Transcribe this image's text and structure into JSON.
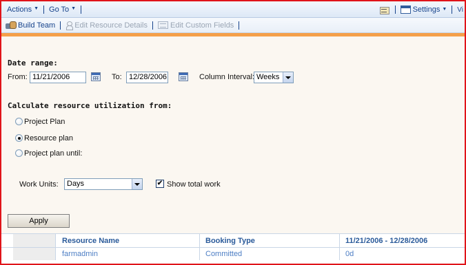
{
  "toolbar": {
    "actions_label": "Actions",
    "goto_label": "Go To",
    "settings_label": "Settings",
    "truncated_label": "Vi"
  },
  "actionbar": {
    "build_team_label": "Build Team",
    "edit_resource_details_label": "Edit Resource Details",
    "edit_custom_fields_label": "Edit Custom Fields"
  },
  "date_range": {
    "heading": "Date range:",
    "from_label": "From:",
    "from_value": "11/21/2006",
    "to_label": "To:",
    "to_value": "12/28/2006",
    "interval_label": "Column Interval:",
    "interval_value": "Weeks"
  },
  "utilization": {
    "heading": "Calculate resource utilization from:",
    "options": [
      {
        "label": "Project Plan",
        "selected": false
      },
      {
        "label": "Resource plan",
        "selected": true
      },
      {
        "label": "Project plan until:",
        "selected": false
      }
    ]
  },
  "work_units": {
    "label": "Work Units:",
    "value": "Days",
    "show_total_label": "Show total work",
    "show_total_checked": true
  },
  "apply_label": "Apply",
  "grid": {
    "headers": [
      "Resource Name",
      "Booking Type",
      "11/21/2006 - 12/28/2006"
    ],
    "rows": [
      [
        "farmadmin",
        "Committed",
        "0d"
      ]
    ]
  },
  "colors": {
    "frame": "#e0141a",
    "accent_orange": "#f5a04a",
    "toolbar_text": "#15428b",
    "grid_header": "#2a5a9a",
    "grid_cell": "#4d7ec4"
  }
}
